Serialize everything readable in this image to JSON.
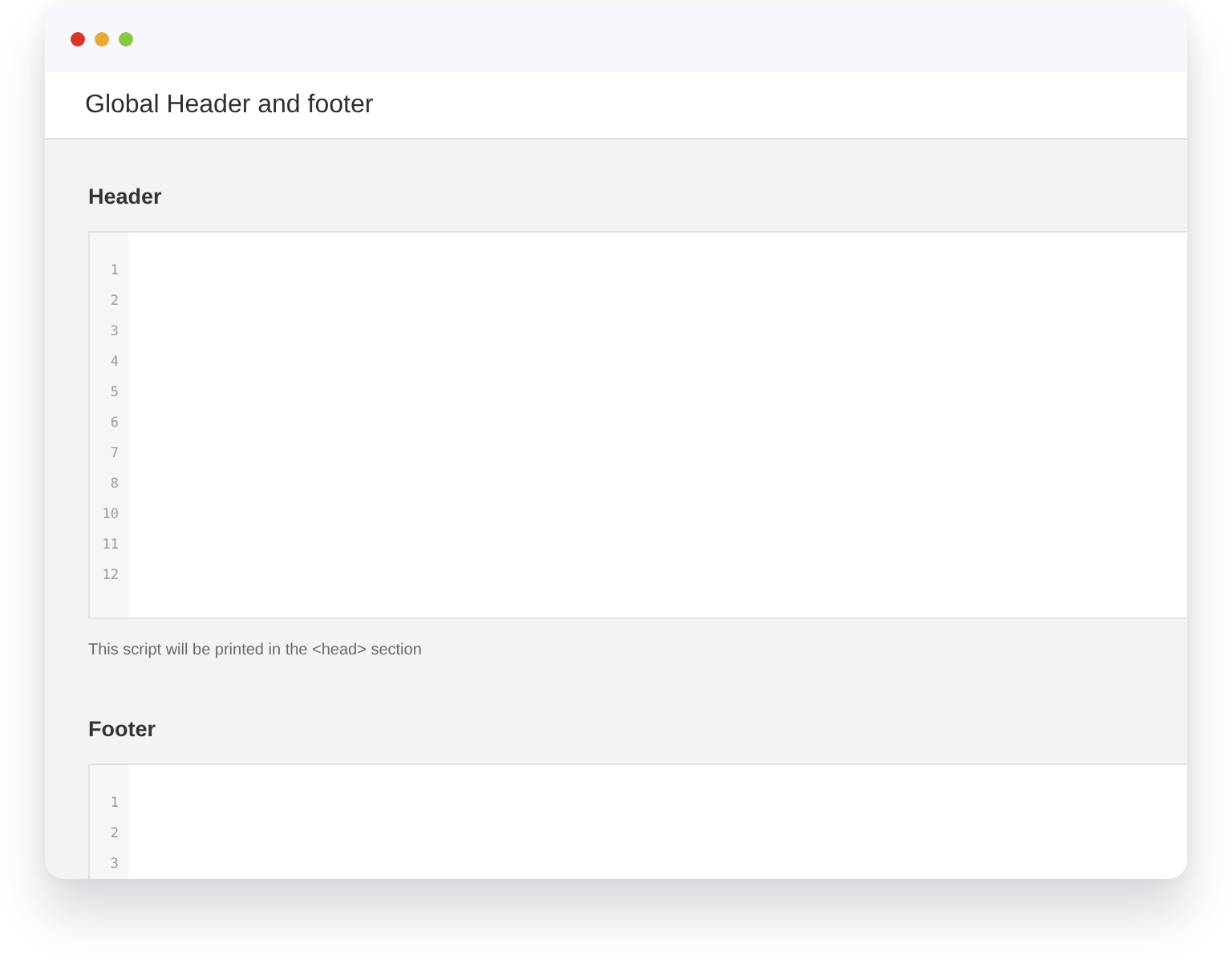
{
  "window": {
    "title": "Global Header and footer",
    "traffic_lights": [
      {
        "color": "#d9352b"
      },
      {
        "color": "#e8a838"
      },
      {
        "color": "#8cc63f"
      }
    ]
  },
  "sections": [
    {
      "label": "Header",
      "line_numbers": [
        "1",
        "2",
        "3",
        "4",
        "5",
        "6",
        "7",
        "8",
        "10",
        "11",
        "12"
      ],
      "hint": "This script will be printed in the <head> section"
    },
    {
      "label": "Footer",
      "line_numbers": [
        "1",
        "2",
        "3"
      ]
    }
  ]
}
